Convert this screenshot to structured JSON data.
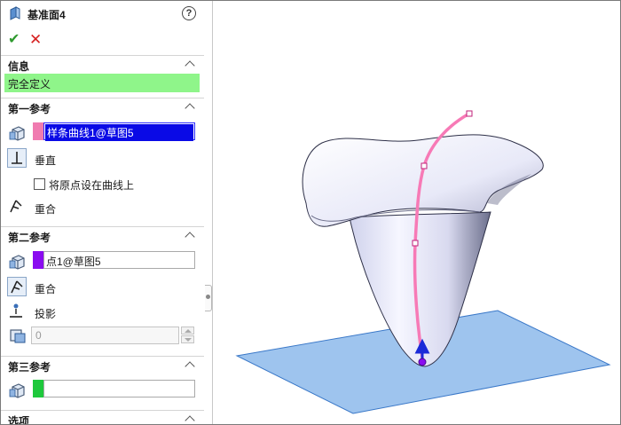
{
  "header": {
    "title": "基准面4",
    "help_label": "?"
  },
  "actions": {
    "ok_symbol": "✔",
    "cancel_symbol": "✕"
  },
  "info": {
    "title": "信息",
    "status": "完全定义",
    "status_color": "#8ff58a"
  },
  "first_ref": {
    "title": "第一参考",
    "value": "样条曲线1@草图5",
    "swatch_color": "#f07bb0",
    "options": [
      {
        "label": "垂直",
        "active": true
      },
      {
        "label": "重合",
        "active": false
      }
    ],
    "checkbox_label": "将原点设在曲线上",
    "checkbox_checked": false
  },
  "second_ref": {
    "title": "第二参考",
    "value": "点1@草图5",
    "swatch_color": "#8a0cf0",
    "options": [
      {
        "label": "重合",
        "active": true
      },
      {
        "label": "投影",
        "active": false
      }
    ],
    "count_value": "0"
  },
  "third_ref": {
    "title": "第三参考",
    "value": "",
    "swatch_color": "#1ec83c"
  },
  "options_section": {
    "title": "选项"
  }
}
